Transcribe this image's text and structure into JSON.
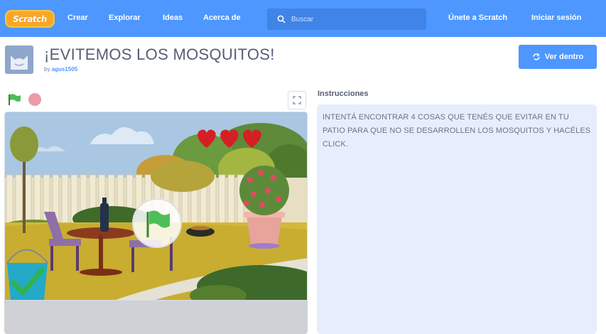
{
  "nav": {
    "logo_text": "Scratch",
    "links": [
      "Crear",
      "Explorar",
      "Ideas",
      "Acerca de"
    ],
    "search_placeholder": "Buscar",
    "join": "Únete a Scratch",
    "signin": "Iniciar sesión",
    "bg_color": "#4d97ff"
  },
  "project": {
    "title": "¡EVITEMOS LOS MOSQUITOS!",
    "by": "by",
    "author": "agus1505",
    "see_inside": "Ver dentro"
  },
  "instructions": {
    "label": "Instrucciones",
    "text": "INTENTÁ ENCONTRAR 4 COSAS QUE TENÉS QUE EVITAR EN TU PATIO PARA QUE NO SE DESARROLLEN LOS MOSQUITOS Y HACÉLES CLICK."
  },
  "stage": {
    "hearts": 3,
    "icons": [
      "green-flag-icon",
      "stop-icon",
      "fullscreen-icon",
      "heart-icon",
      "checkmark-icon"
    ]
  }
}
